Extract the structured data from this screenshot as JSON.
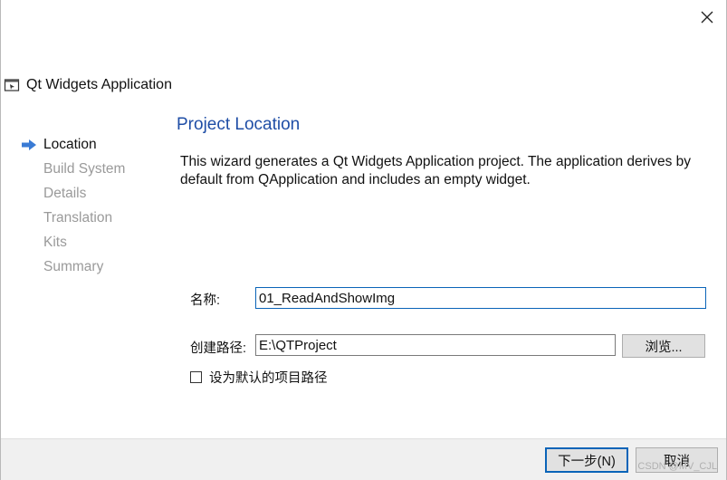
{
  "window": {
    "title": "Qt Widgets Application",
    "close_icon": "close-icon"
  },
  "steps": [
    {
      "label": "Location",
      "active": true
    },
    {
      "label": "Build System",
      "active": false
    },
    {
      "label": "Details",
      "active": false
    },
    {
      "label": "Translation",
      "active": false
    },
    {
      "label": "Kits",
      "active": false
    },
    {
      "label": "Summary",
      "active": false
    }
  ],
  "page": {
    "title": "Project Location",
    "description": "This wizard generates a Qt Widgets Application project. The application derives by default from QApplication and includes an empty widget."
  },
  "form": {
    "name_label": "名称:",
    "name_value": "01_ReadAndShowImg",
    "path_label": "创建路径:",
    "path_value": "E:\\QTProject",
    "browse_label": "浏览...",
    "default_path_label": "设为默认的项目路径",
    "default_path_checked": false
  },
  "footer": {
    "next_label": "下一步(N)",
    "cancel_label": "取消"
  },
  "watermark": "CSDN @MV_CJL",
  "colors": {
    "title_blue": "#1f4ea6",
    "arrow_blue": "#3a7bd5",
    "focus_border": "#0a64b8"
  }
}
